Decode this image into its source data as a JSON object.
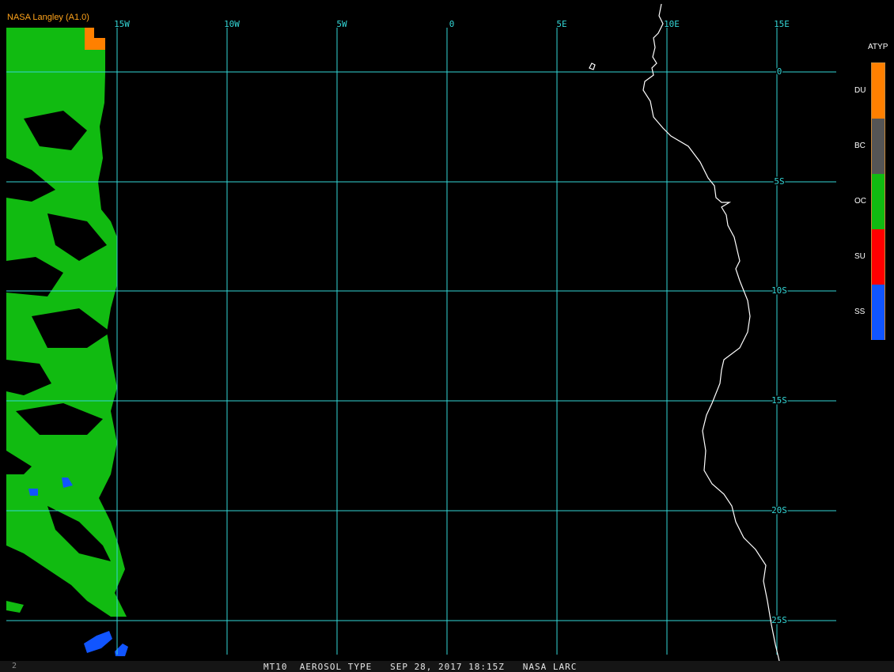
{
  "provider_label": "NASA Langley (A1.0)",
  "footer": {
    "text": "MT10  AEROSOL TYPE   SEP 28, 2017 18:15Z   NASA LARC",
    "corner_mark": "2"
  },
  "colors": {
    "background": "#000000",
    "grid": "#33d6d6",
    "coast": "#ffffff",
    "provider": "#ffa31a"
  },
  "map": {
    "lon_labels": [
      "15W",
      "10W",
      "5W",
      "0",
      "5E",
      "10E",
      "15E"
    ],
    "lat_labels": [
      "0",
      "5S",
      "10S",
      "15S",
      "20S",
      "25S"
    ]
  },
  "legend": {
    "title": "ATYP",
    "items": [
      {
        "label": "DU",
        "color": "#ff8000"
      },
      {
        "label": "BC",
        "color": "#555555"
      },
      {
        "label": "OC",
        "color": "#11bb11"
      },
      {
        "label": "SU",
        "color": "#ff0000"
      },
      {
        "label": "SS",
        "color": "#1155ff"
      }
    ]
  }
}
